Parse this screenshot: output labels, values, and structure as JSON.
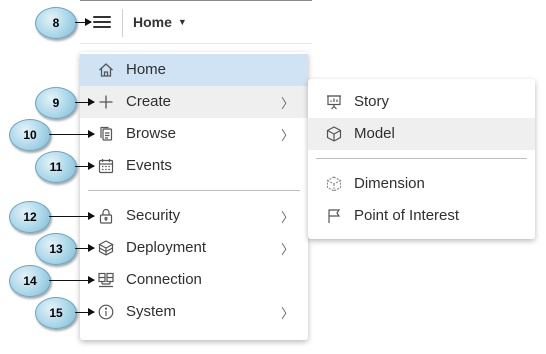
{
  "topbar": {
    "current_page": "Home"
  },
  "menu": {
    "items": [
      {
        "label": "Home"
      },
      {
        "label": "Create"
      },
      {
        "label": "Browse"
      },
      {
        "label": "Events"
      },
      {
        "label": "Security"
      },
      {
        "label": "Deployment"
      },
      {
        "label": "Connection"
      },
      {
        "label": "System"
      }
    ]
  },
  "submenu": {
    "items": [
      {
        "label": "Story"
      },
      {
        "label": "Model"
      },
      {
        "label": "Dimension"
      },
      {
        "label": "Point of Interest"
      }
    ]
  },
  "callouts": [
    "8",
    "9",
    "10",
    "11",
    "12",
    "13",
    "14",
    "15"
  ],
  "icons": {
    "hamburger": "hamburger-icon",
    "home": "home-icon",
    "create": "plus-icon",
    "browse": "files-icon",
    "events": "calendar-icon",
    "security": "lock-icon",
    "deployment": "cube-network-icon",
    "connection": "connection-icon",
    "system": "info-icon",
    "story": "presentation-icon",
    "model": "cube-icon",
    "dimension": "dimension-icon",
    "point_of_interest": "flag-icon"
  },
  "colors": {
    "selected_bg": "#cfe3f4",
    "hover_bg": "#efefef",
    "callout_fill": "#a9d6e8"
  }
}
